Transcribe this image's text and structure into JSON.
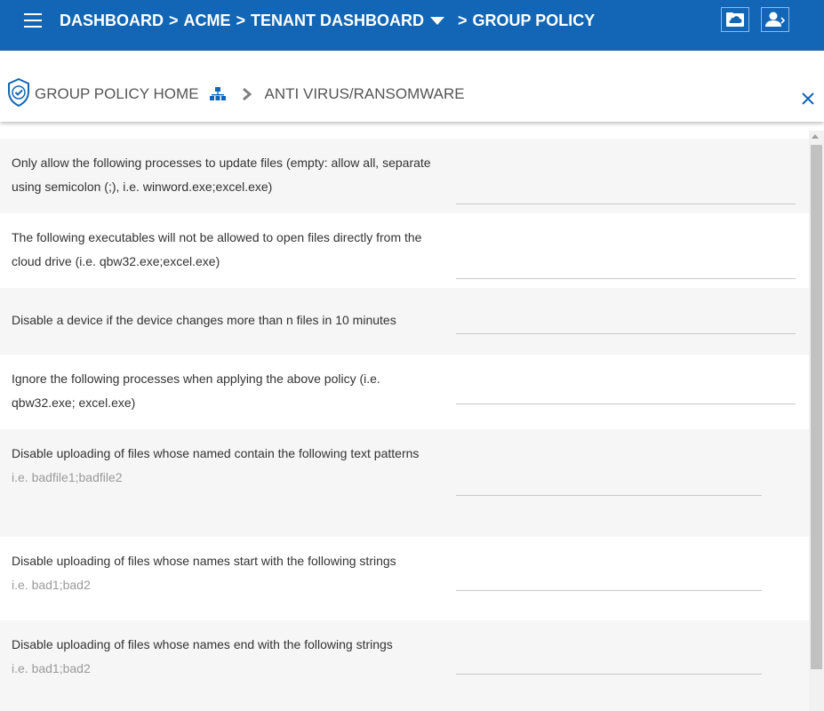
{
  "topbar": {
    "crumbs": [
      "DASHBOARD",
      "ACME",
      "TENANT DASHBOARD",
      "GROUP POLICY"
    ],
    "separator": ">",
    "background": "#1266b5"
  },
  "header": {
    "home_label": "GROUP POLICY HOME",
    "current_label": "ANTI VIRUS/RANSOMWARE"
  },
  "settings": [
    {
      "label": "Only allow the following processes to update files (empty: allow all, separate using semicolon (;), i.e. winword.exe;excel.exe)",
      "value": ""
    },
    {
      "label": "The following executables will not be allowed to open files directly from the cloud drive (i.e. qbw32.exe;excel.exe)",
      "value": ""
    },
    {
      "label": "Disable a device if the device changes more than n files in 10 minutes",
      "value": ""
    },
    {
      "label": "Ignore the following processes when applying the above policy (i.e. qbw32.exe; excel.exe)",
      "value": ""
    },
    {
      "label": "Disable uploading of files whose named contain the following text patterns",
      "hint": "i.e. badfile1;badfile2",
      "value": ""
    },
    {
      "label": "Disable uploading of files whose names start with the following strings",
      "hint": "i.e. bad1;bad2",
      "value": ""
    },
    {
      "label": "Disable uploading of files whose names end with the following strings",
      "hint": "i.e. bad1;bad2",
      "value": ""
    }
  ]
}
